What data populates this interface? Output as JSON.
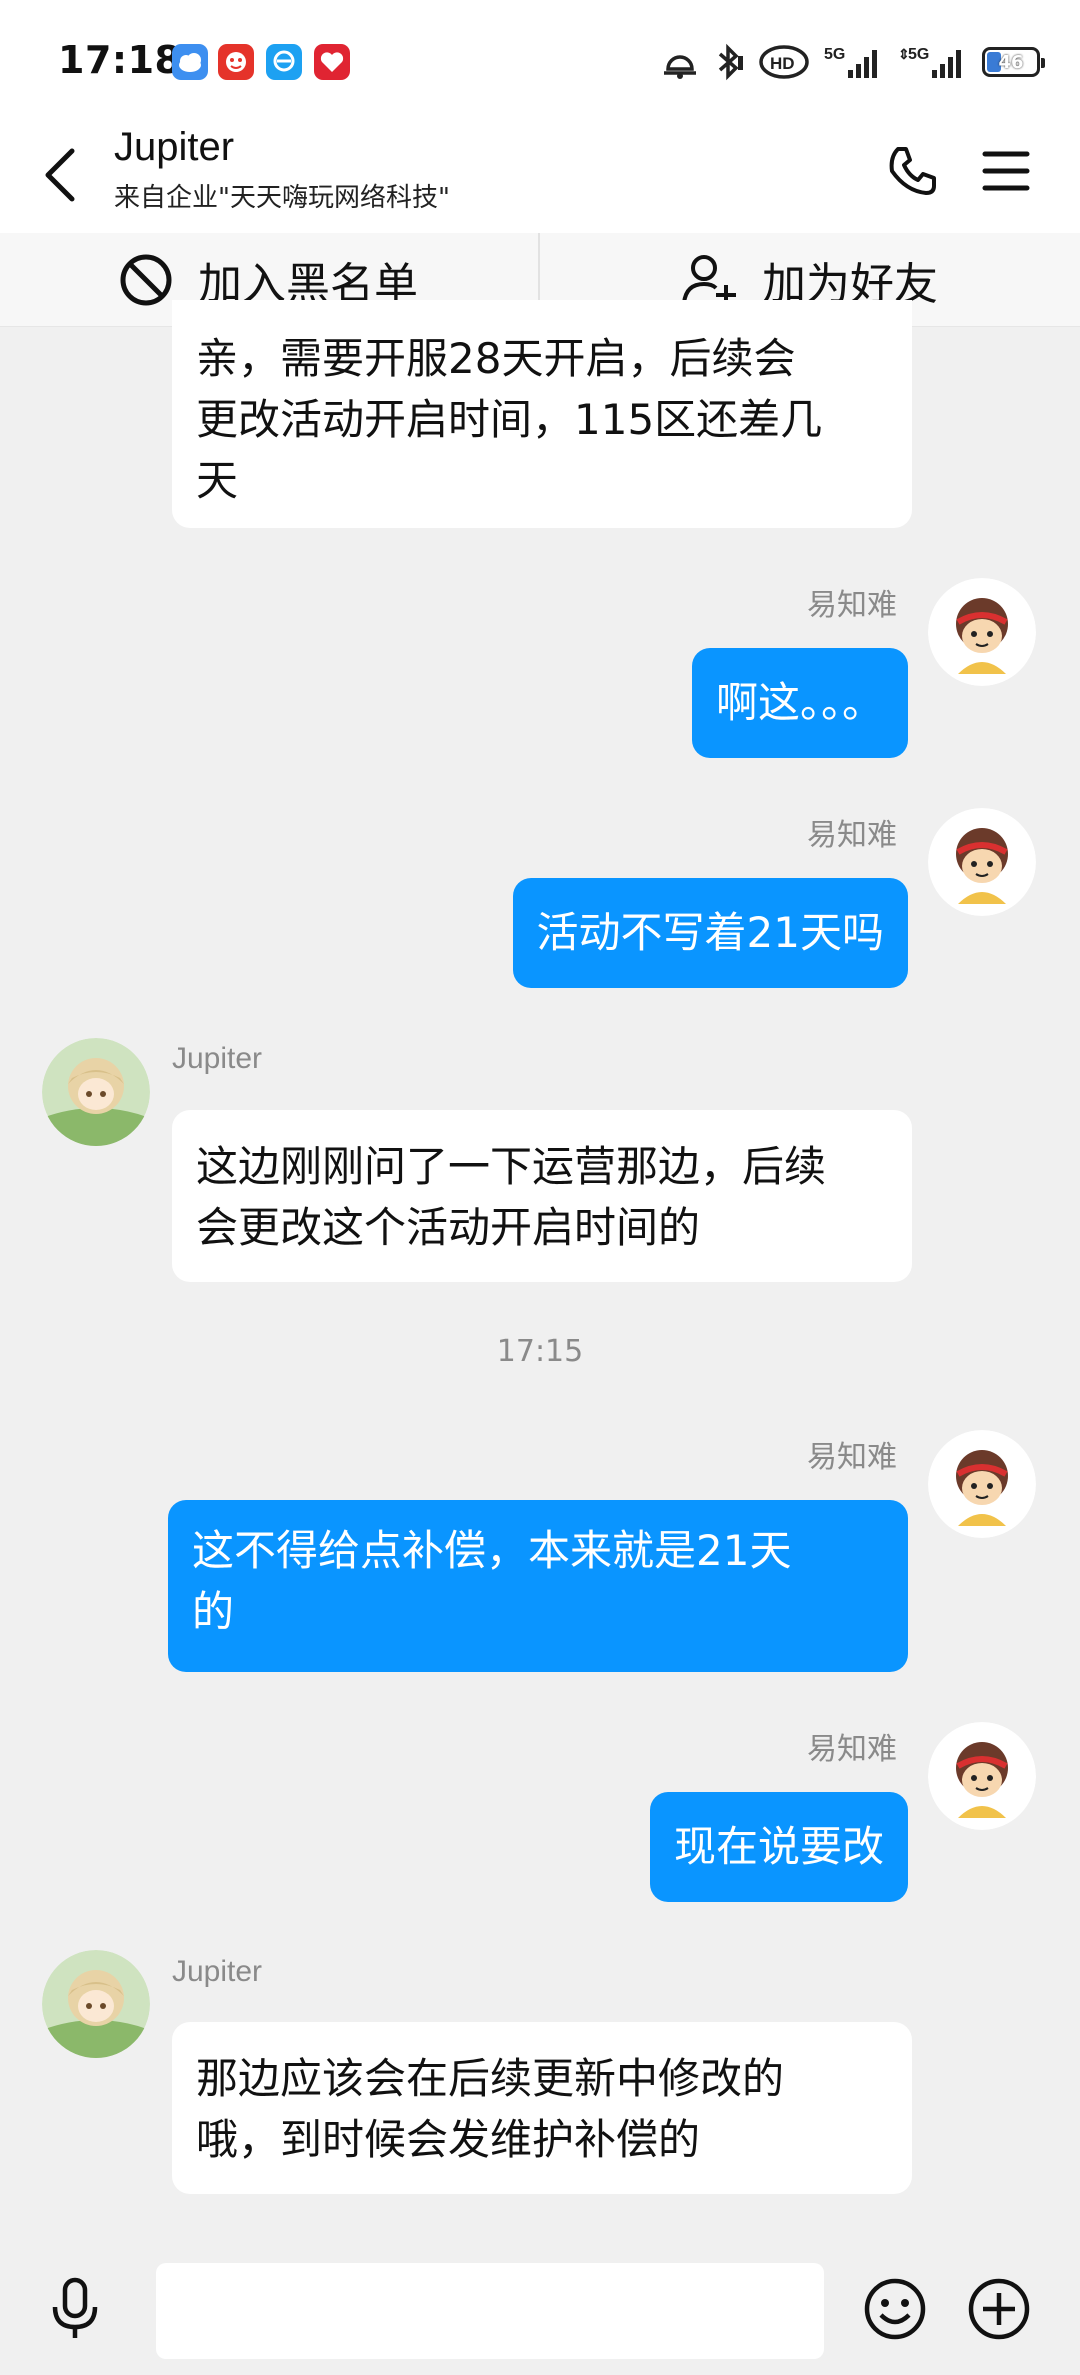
{
  "status_bar": {
    "time": "17:18",
    "battery_level": "46",
    "app_icons": [
      "weather-app-icon",
      "shopping-app-icon",
      "browser-app-icon",
      "heart-app-icon"
    ],
    "network": [
      "5G",
      "5G"
    ]
  },
  "header": {
    "contact_name": "Jupiter",
    "contact_subtitle": "来自企业\"天天嗨玩网络科技\""
  },
  "actions": {
    "block_label": "加入黑名单",
    "add_friend_label": "加为好友"
  },
  "messages": [
    {
      "direction": "incoming",
      "sender": "",
      "lines": [
        "亲，需要开服28天开启，后续会",
        "更改活动开启时间，115区还差几",
        "天"
      ]
    },
    {
      "direction": "outgoing",
      "sender": "易知难",
      "lines": [
        "啊这。。。"
      ]
    },
    {
      "direction": "outgoing",
      "sender": "易知难",
      "lines": [
        "活动不写着21天吗"
      ]
    },
    {
      "direction": "incoming",
      "sender": "Jupiter",
      "lines": [
        "这边刚刚问了一下运营那边，后续",
        "会更改这个活动开启时间的"
      ]
    },
    {
      "direction": "outgoing",
      "sender": "易知难",
      "lines": [
        "这不得给点补偿，本来就是21天",
        "的"
      ]
    },
    {
      "direction": "outgoing",
      "sender": "易知难",
      "lines": [
        "现在说要改"
      ]
    },
    {
      "direction": "incoming",
      "sender": "Jupiter",
      "lines": [
        "那边应该会在后续更新中修改的",
        "哦，到时候会发维护补偿的"
      ]
    }
  ],
  "timestamp": "17:15",
  "input": {
    "value": "",
    "placeholder": ""
  },
  "colors": {
    "outgoing_bubble": "#0a95ff",
    "incoming_bubble": "#ffffff",
    "background": "#f0f0f0"
  }
}
